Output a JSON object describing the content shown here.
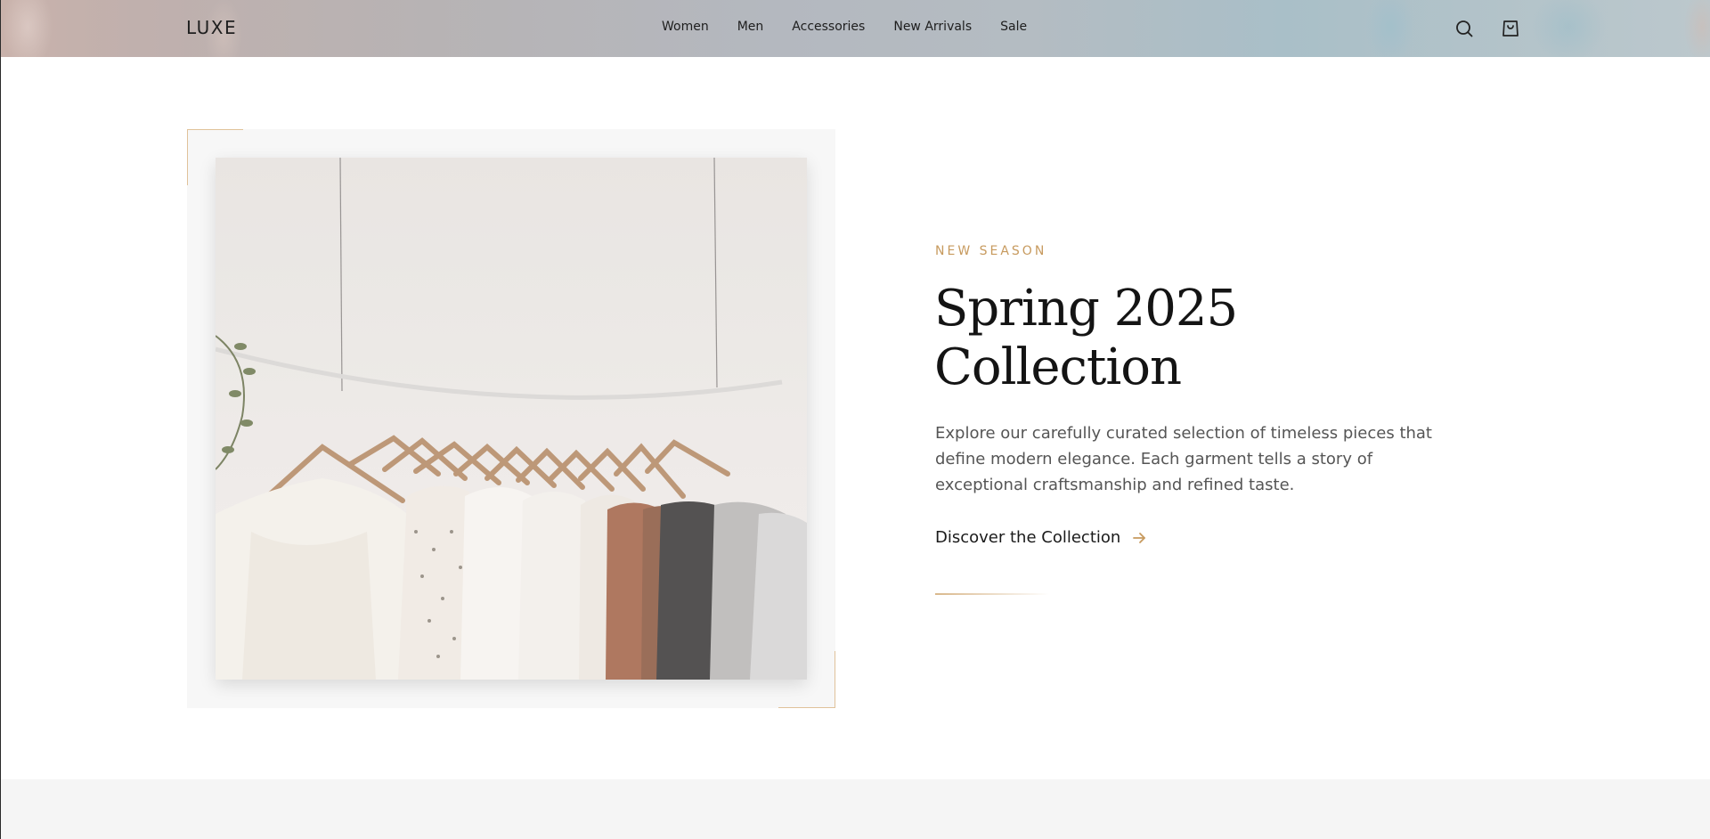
{
  "header": {
    "logo": "LUXE",
    "nav": [
      "Women",
      "Men",
      "Accessories",
      "New Arrivals",
      "Sale"
    ],
    "icons": [
      "search-icon",
      "shopping-bag-icon"
    ]
  },
  "hero": {
    "eyebrow": "NEW SEASON",
    "title_line1": "Spring 2025",
    "title_line2": "Collection",
    "description": "Explore our carefully curated selection of timeless pieces that define modern elegance. Each garment tells a story of exceptional craftsmanship and refined taste.",
    "cta_label": "Discover the Collection",
    "image_alt": "clothing-rack-photo"
  },
  "colors": {
    "accent": "#c79a5e",
    "text": "#141414",
    "muted": "#555555",
    "section_bg": "#f5f5f5"
  }
}
